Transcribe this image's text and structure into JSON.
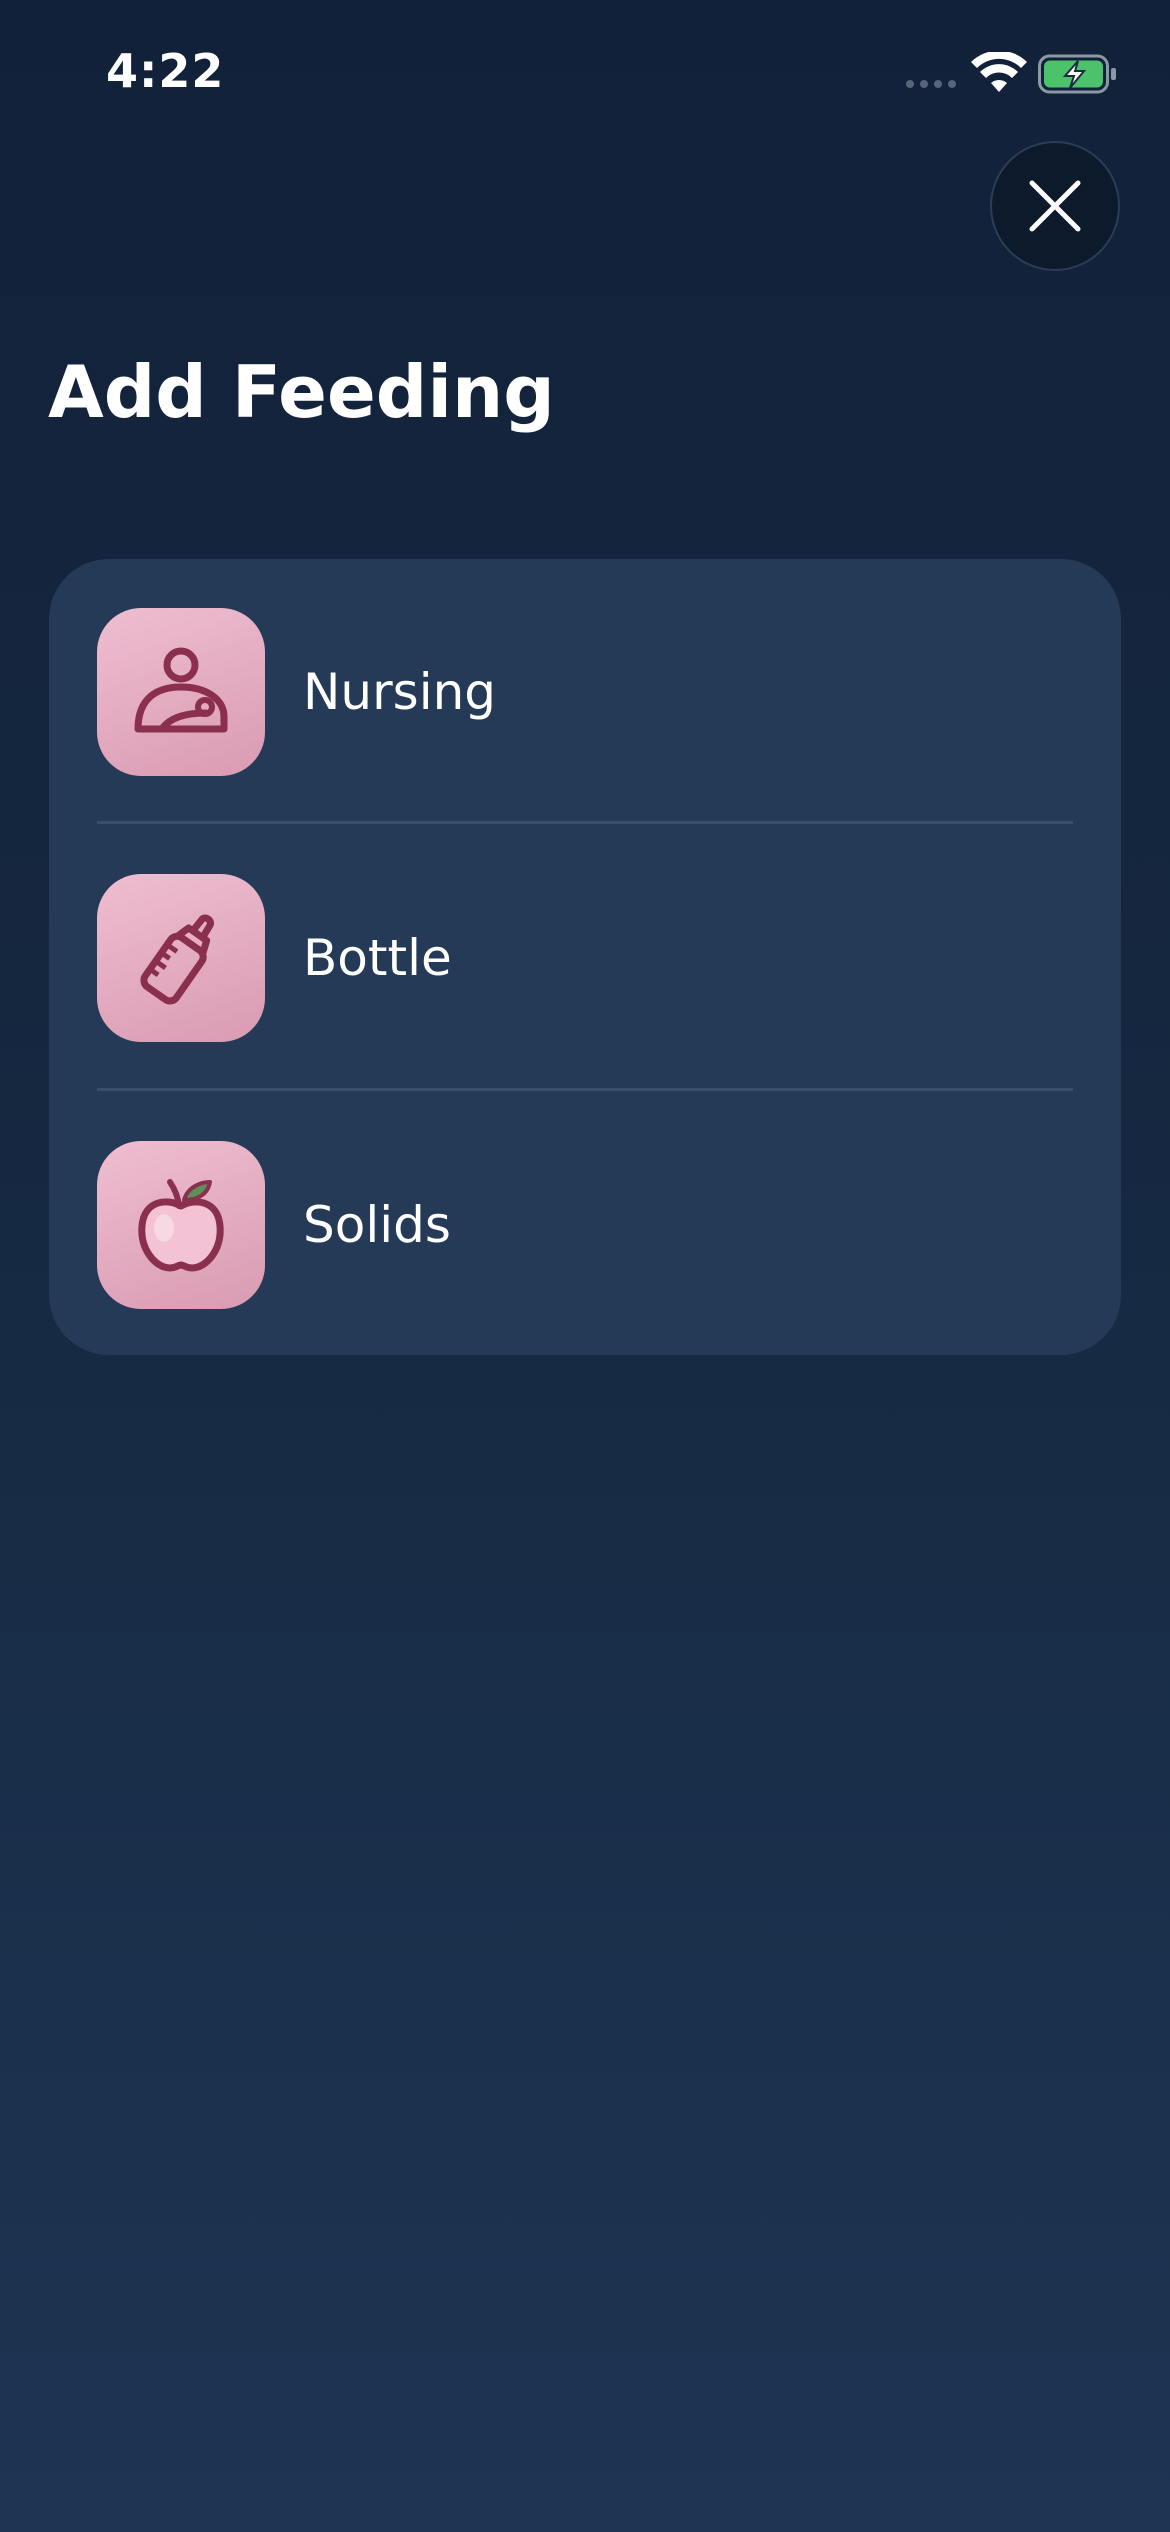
{
  "status_bar": {
    "time": "4:22"
  },
  "header": {
    "title": "Add Feeding"
  },
  "options": [
    {
      "id": "nursing",
      "label": "Nursing",
      "icon": "nursing-icon"
    },
    {
      "id": "bottle",
      "label": "Bottle",
      "icon": "baby-bottle-icon"
    },
    {
      "id": "solids",
      "label": "Solids",
      "icon": "apple-icon"
    }
  ],
  "colors": {
    "background_top": "#12213a",
    "background_bottom": "#1d3553",
    "card": "#243a56",
    "icon_tile": "#e2a9bf",
    "icon_stroke": "#8a2f4e",
    "battery_fill": "#4cc36a"
  }
}
